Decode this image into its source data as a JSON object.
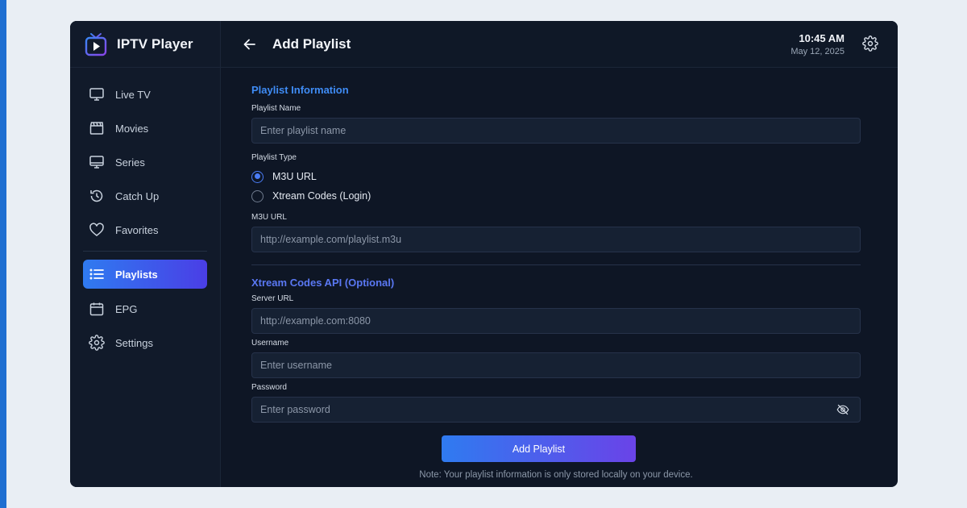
{
  "app": {
    "title": "IPTV Player"
  },
  "header": {
    "title": "Add Playlist",
    "time": "10:45 AM",
    "date": "May 12, 2025"
  },
  "sidebar": {
    "items": [
      {
        "label": "Live TV",
        "icon": "tv-icon"
      },
      {
        "label": "Movies",
        "icon": "clapperboard-icon"
      },
      {
        "label": "Series",
        "icon": "monitor-icon"
      },
      {
        "label": "Catch Up",
        "icon": "history-icon"
      },
      {
        "label": "Favorites",
        "icon": "heart-icon"
      },
      {
        "label": "Playlists",
        "icon": "list-icon",
        "active": true
      },
      {
        "label": "EPG",
        "icon": "calendar-icon"
      },
      {
        "label": "Settings",
        "icon": "gear-icon"
      }
    ]
  },
  "form": {
    "section1_title": "Playlist Information",
    "name_label": "Playlist Name",
    "name_placeholder": "Enter playlist name",
    "type_label": "Playlist Type",
    "type_options": [
      "M3U URL",
      "Xtream Codes (Login)"
    ],
    "type_selected": "M3U URL",
    "m3u_label": "M3U URL",
    "m3u_placeholder": "http://example.com/playlist.m3u",
    "section2_title": "Xtream Codes API (Optional)",
    "server_label": "Server URL",
    "server_placeholder": "http://example.com:8080",
    "username_label": "Username",
    "username_placeholder": "Enter username",
    "password_label": "Password",
    "password_placeholder": "Enter password",
    "submit_label": "Add Playlist",
    "note": "Note: Your playlist information is only stored locally on your device."
  },
  "colors": {
    "accent": "#3f8cf5",
    "gradient_start": "#2f7bf0",
    "gradient_end": "#6a43e8",
    "window_bg": "#0e1625"
  }
}
